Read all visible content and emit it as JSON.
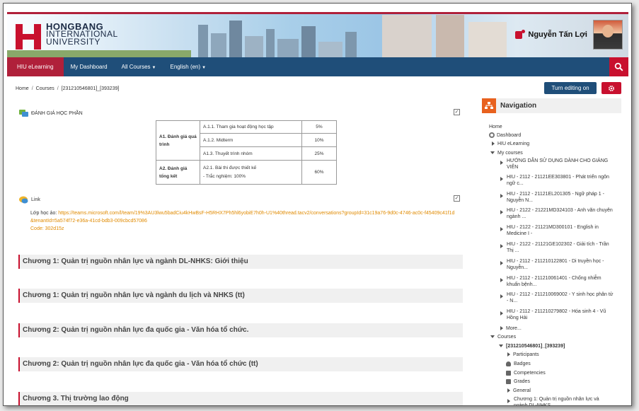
{
  "header": {
    "logo": {
      "line1": "HONGBANG",
      "line2": "INTERNATIONAL",
      "line3": "UNIVERSITY"
    },
    "user_name": "Nguyễn Tấn Lợi"
  },
  "nav": {
    "items": [
      {
        "label": "HIU eLearning"
      },
      {
        "label": "My Dashboard"
      },
      {
        "label": "All Courses"
      },
      {
        "label": "English (en)"
      }
    ]
  },
  "breadcrumb": [
    "Home",
    "Courses",
    "[231210546801]_[393239]"
  ],
  "actions": {
    "edit_label": "Turn editing on"
  },
  "modules": {
    "assessment_title": "ĐÁNH GIÁ HỌC PHẦN",
    "link_title": "Link"
  },
  "grade_table": [
    {
      "group": "A1. Đánh giá quá trình",
      "items": [
        {
          "name": "A.1.1. Tham gia hoạt động học tập",
          "weight": "5%"
        },
        {
          "name": "A.1.2. Midterm",
          "weight": "10%"
        },
        {
          "name": "A1.3. Thuyết trình nhóm",
          "weight": "25%"
        }
      ]
    },
    {
      "group": "A2. Đánh giá tổng kết",
      "items": [
        {
          "name": "A2.1. Bài thi được thiết kế",
          "sub": "- Trắc nghiệm: 100%",
          "weight": "60%"
        }
      ]
    }
  ],
  "link": {
    "label": "Lớp học ảo:",
    "url": "https://teams.microsoft.com/l/team/19%3AU3lwu5badCiu4kHwBsF-H5RHX7Ph5hl6yobiE7h0h-U1%40thread.tacv2/conversations?groupId=31c19a76-9d0c-4746-ac0c-f45409c41f1d&tenantId=5a574f72-e36a-41cd-bdb3-009cbcd57086",
    "code": "Code: 302d15z"
  },
  "chapters": [
    "Chương 1: Quản trị nguồn nhân lực và ngành DL-NHKS: Giới thiệu",
    "Chương 1: Quản trị nguồn nhân lực và ngành du lịch và NHKS (tt)",
    "Chương 2: Quản trị nguồn nhân lực đa quốc gia - Văn hóa tổ chức.",
    "Chương 2: Quản trị nguồn nhân lực đa quốc gia - Văn hóa tổ chức (tt)",
    "Chương 3. Thị trường lao động"
  ],
  "navigation": {
    "title": "Navigation",
    "home": "Home",
    "dashboard": "Dashboard",
    "elearning": "HIU eLearning",
    "my_courses": "My courses",
    "courses_list": [
      "HƯỚNG DẪN SỬ DỤNG DÀNH CHO GIẢNG VIÊN",
      "HIU - 2112 - 21121EE303801 - Phát triển ngôn ngữ c...",
      "HIU - 2112 - 21121EL201305 - Ngữ pháp 1 - Nguyễn N...",
      "HIU - 2122 - 21221MD324103 - Anh văn chuyên ngành ...",
      "HIU - 2122 - 21121MD300101 - English in Medicine I -",
      "HIU - 2122 - 21121GE102302 - Giải tích - Trần Thị ...",
      "HIU - 2112 - 211210122801 - Di truyền học - Nguyễn...",
      "HIU - 2112 - 211210061401 - Chống nhiễm khuẩn bệnh...",
      "HIU - 2112 - 211210069002 - Y sinh học phân tử - N...",
      "HIU - 2112 - 211210279802 - Hóa sinh 4 - Vũ Hồng Hải"
    ],
    "more": "More...",
    "courses": "Courses",
    "current_course": "[231210546801]_[393239]",
    "participants": "Participants",
    "badges": "Badges",
    "competencies": "Competencies",
    "grades": "Grades",
    "general": "General",
    "chapter1": "Chương 1: Quản trị nguồn nhân lực và ngành DL-NHKS"
  },
  "colors": {
    "brand_red": "#c8102e",
    "navbar": "#1f4e79",
    "nav_orange": "#e8611e"
  }
}
